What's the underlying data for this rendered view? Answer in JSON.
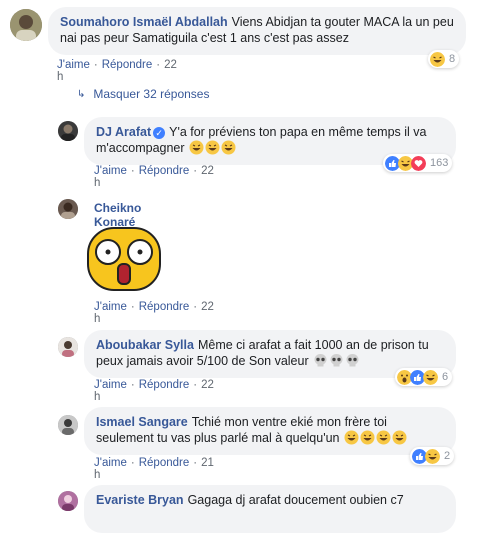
{
  "comments": [
    {
      "author": "Soumahoro Ismaël Abdallah",
      "text": "Viens Abidjan ta gouter MACA la un peu nai pas peur Samatiguila c'est 1 ans c'est pas assez",
      "like": "J'aime",
      "reply": "Répondre",
      "time": "22 h",
      "reaction_count": "8"
    },
    {
      "author": "DJ Arafat",
      "text": "Y'a for préviens ton papa en même temps il va m'accompagner",
      "like": "J'aime",
      "reply": "Répondre",
      "time": "22 h",
      "reaction_count": "163"
    },
    {
      "author": "Cheikno Konaré",
      "like": "J'aime",
      "reply": "Répondre",
      "time": "22 h"
    },
    {
      "author": "Aboubakar Sylla",
      "text": "Même ci arafat a fait 1000 an de prison tu peux jamais avoir 5/100 de Son valeur",
      "like": "J'aime",
      "reply": "Répondre",
      "time": "22 h",
      "reaction_count": "6"
    },
    {
      "author": "Ismael Sangare",
      "text": "Tchié mon ventre ekié mon frère toi seulement tu vas plus parlé mal à quelqu'un",
      "like": "J'aime",
      "reply": "Répondre",
      "time": "21 h",
      "reaction_count": "2"
    },
    {
      "author": "Evariste Bryan",
      "text": "Gagaga dj arafat doucement oubien c7"
    }
  ],
  "hide_replies": "Masquer 32 réponses",
  "colors": {
    "link": "#385898",
    "bubble": "#f2f3f5",
    "meta": "#606770",
    "like_blue": "#4080ff",
    "haha_yellow": "#f7c744",
    "love_red": "#f33e58"
  }
}
